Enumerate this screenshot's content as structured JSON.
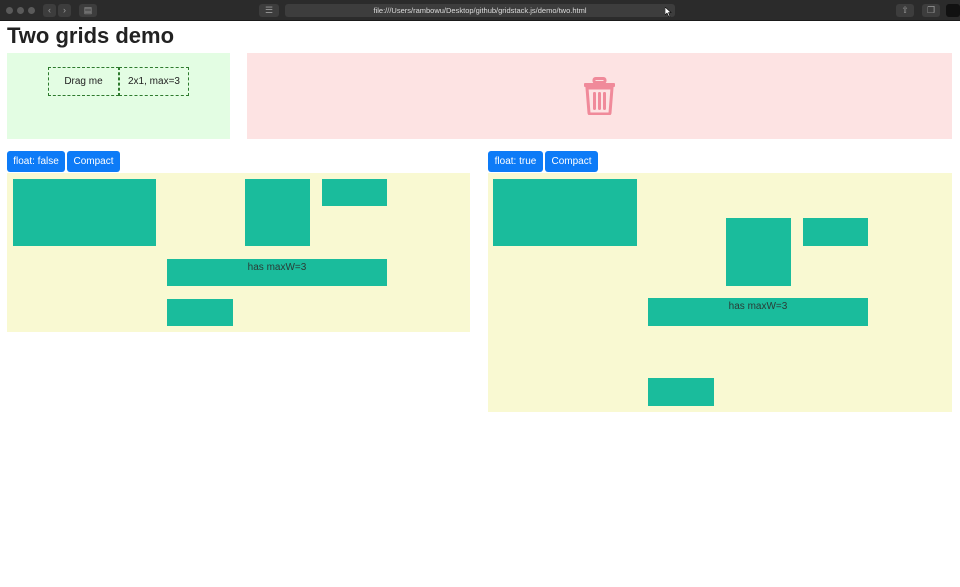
{
  "browser": {
    "url": "file:///Users/rambowu/Desktop/github/gridstack.js/demo/two.html"
  },
  "page": {
    "title": "Two grids demo"
  },
  "sidebar": {
    "items": [
      {
        "label": "Drag me"
      },
      {
        "label": "2x1, max=3"
      }
    ]
  },
  "trash": {
    "icon": "trash-icon",
    "color": "#f08a9a"
  },
  "left_grid": {
    "float_button": "float: false",
    "compact_button": "Compact",
    "tile_label": "has maxW=3"
  },
  "right_grid": {
    "float_button": "float: true",
    "compact_button": "Compact",
    "tile_label": "has maxW=3"
  },
  "colors": {
    "tile": "#1abc9c",
    "grid_bg": "#f9f9d2",
    "sidebar_bg": "#e3fde3",
    "trash_bg": "#fde3e3",
    "button": "#0d7bf7"
  }
}
